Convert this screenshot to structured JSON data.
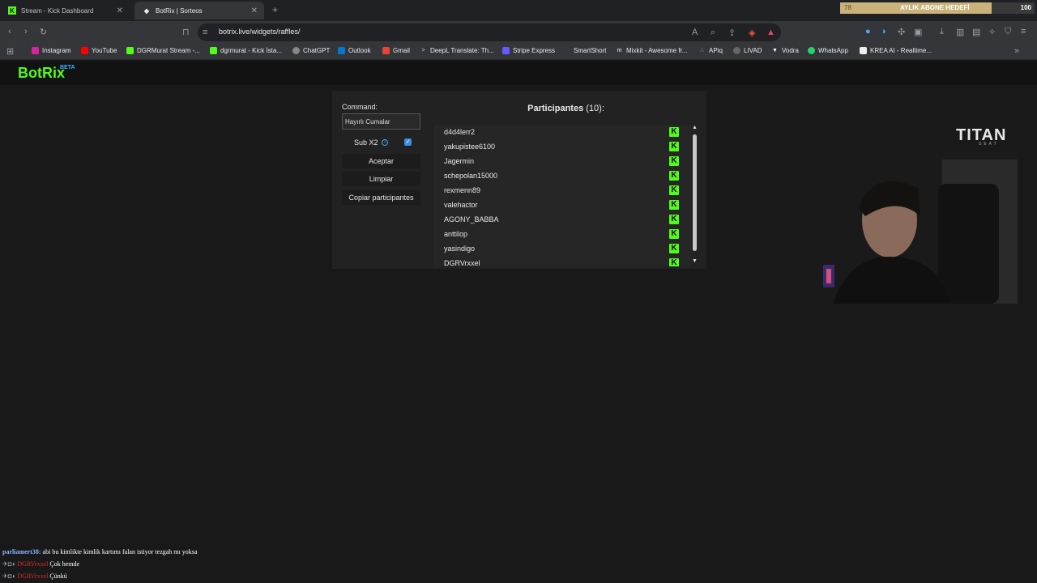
{
  "tabs": [
    {
      "title": "Stream - Kick Dashboard",
      "active": false
    },
    {
      "title": "BotRix | Sorteos",
      "active": true
    }
  ],
  "goal": {
    "current": "78",
    "label": "AYLIK ABONE HEDEFİ",
    "max": "100",
    "progress": 0.78
  },
  "address_bar": {
    "url": "botrix.live/widgets/raffles/"
  },
  "bookmarks": [
    "Instagram",
    "YouTube",
    "DGRMurat Stream -...",
    "dgrmurat - Kick İsta...",
    "ChatGPT",
    "Outlook",
    "Gmail",
    "DeepL Translate: Th...",
    "Stripe Express",
    "SmartShort",
    "Mixkit - Awesome fr...",
    "APiq",
    "LIVAD",
    "Vodra",
    "WhatsApp",
    "KREA AI - Realtime..."
  ],
  "app": {
    "logo": "BotRix",
    "beta": "BETA"
  },
  "raffle": {
    "command_label": "Command:",
    "command_value": "Hayırlı Cumalar",
    "sub_label": "Sub X2",
    "sub_checked": true,
    "accept_label": "Aceptar",
    "clear_label": "Limpiar",
    "copy_label": "Copiar participantes",
    "participants_title": "Participantes",
    "participants_count": "(10):",
    "participants": [
      "d4d4lerr2",
      "yakupistee6100",
      "Jagermin",
      "schepolan15000",
      "rexmenn89",
      "valehactor",
      "AGONY_BABBA",
      "anttilop",
      "yasindigo",
      "DGRVrxxel"
    ]
  },
  "overlay": {
    "brand": "TITAN",
    "brand_sub": "SEAT"
  },
  "chat": [
    {
      "user": "parliamert38:",
      "message": "abi bu kimlikte kimlik kartımı falan istiyor tezgah mı yoksa"
    },
    {
      "user": "DGRVrxxel",
      "message": "Çok hemde"
    },
    {
      "user": "DGRVrxxel",
      "message": "Çünkü"
    }
  ]
}
